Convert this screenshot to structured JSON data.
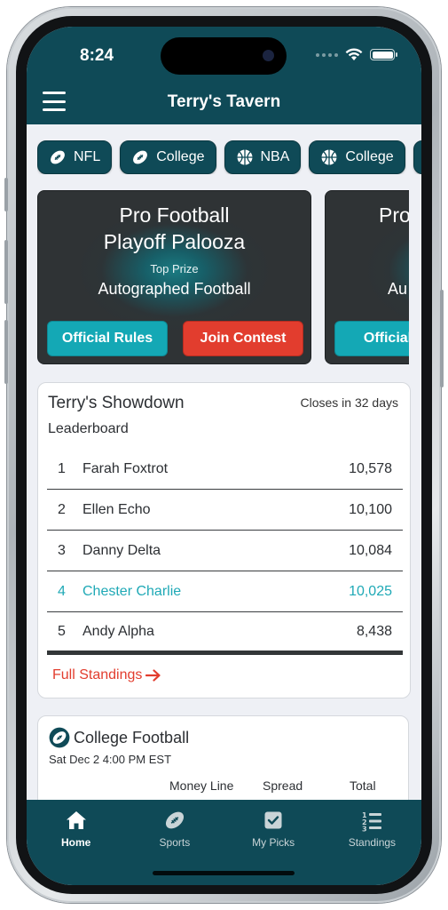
{
  "status_bar": {
    "time": "8:24"
  },
  "header": {
    "title": "Terry's Tavern"
  },
  "chips": [
    {
      "label": "NFL",
      "icon": "football-icon"
    },
    {
      "label": "College",
      "icon": "football-icon"
    },
    {
      "label": "NBA",
      "icon": "basketball-icon"
    },
    {
      "label": "College",
      "icon": "basketball-icon"
    },
    {
      "label": "",
      "icon": "football-icon"
    }
  ],
  "contests": [
    {
      "title_line1": "Pro Football",
      "title_line2": "Playoff Palooza",
      "prize_label": "Top Prize",
      "prize": "Autographed Football",
      "rules_label": "Official Rules",
      "join_label": "Join Contest"
    },
    {
      "title_line1": "Pro",
      "title_line2": "",
      "prize_label": "",
      "prize": "Au",
      "rules_label": "Official R",
      "join_label": ""
    }
  ],
  "leaderboard": {
    "title": "Terry's Showdown",
    "closes": "Closes in 32 days",
    "subtitle": "Leaderboard",
    "rows": [
      {
        "rank": "1",
        "name": "Farah Foxtrot",
        "points": "10,578"
      },
      {
        "rank": "2",
        "name": "Ellen Echo",
        "points": "10,100"
      },
      {
        "rank": "3",
        "name": "Danny Delta",
        "points": "10,084"
      },
      {
        "rank": "4",
        "name": "Chester Charlie",
        "points": "10,025"
      },
      {
        "rank": "5",
        "name": "Andy Alpha",
        "points": "8,438"
      }
    ],
    "full_standings": "Full Standings"
  },
  "game": {
    "title": "College Football",
    "time": "Sat Dec 2 4:00 PM EST",
    "columns": [
      "Money Line",
      "Spread",
      "Total"
    ]
  },
  "tabs": [
    {
      "label": "Home",
      "icon": "home-icon"
    },
    {
      "label": "Sports",
      "icon": "football-icon"
    },
    {
      "label": "My Picks",
      "icon": "check-square-icon"
    },
    {
      "label": "Standings",
      "icon": "ordered-list-icon"
    }
  ],
  "colors": {
    "brand": "#0f4a57",
    "accent_teal": "#14a8b5",
    "accent_red": "#e23d2e",
    "highlight_row": "#1fa9b6"
  }
}
